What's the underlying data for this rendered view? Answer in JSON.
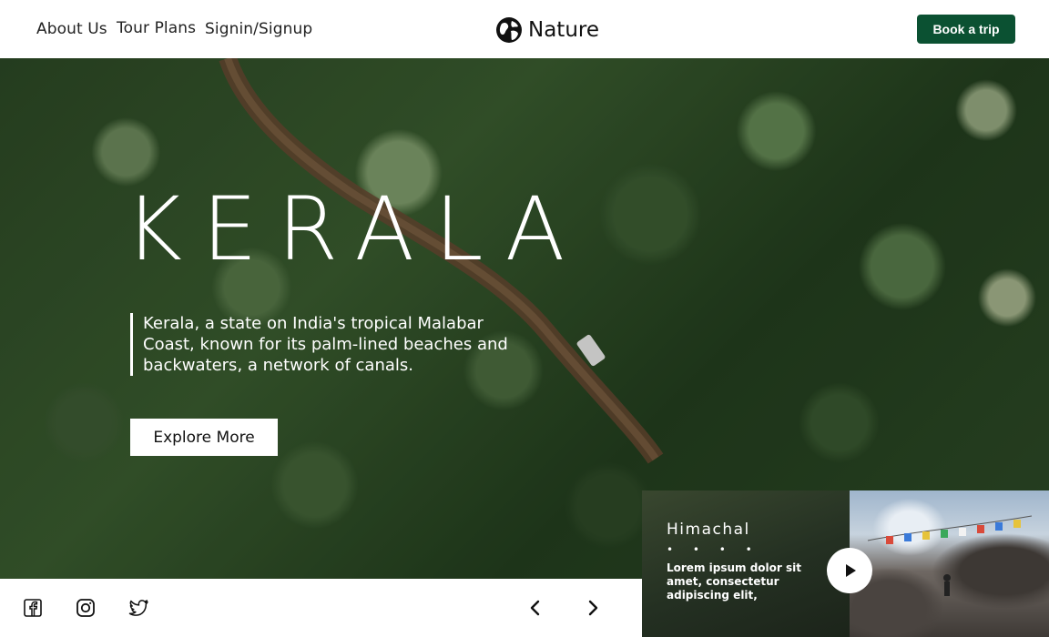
{
  "nav": {
    "links": [
      "About Us",
      "Tour Plans",
      "Signin/Signup"
    ],
    "logo_text": "Nature",
    "logo_icon": "globe-icon",
    "cta_label": "Book a trip",
    "cta_color": "#0b5132"
  },
  "hero": {
    "title": "KERALA",
    "description": "Kerala, a state on India's tropical Malabar Coast, known for its palm-lined beaches and backwaters, a network of canals.",
    "button_label": "Explore More"
  },
  "social": {
    "icons": [
      "facebook-icon",
      "instagram-icon",
      "twitter-icon"
    ]
  },
  "slider": {
    "prev_icon": "chevron-left-icon",
    "next_icon": "chevron-right-icon"
  },
  "card": {
    "title": "Himachal",
    "dots": "• • • •",
    "text": "Lorem ipsum dolor sit amet, consectetur adipiscing elit,",
    "play_icon": "play-icon"
  }
}
